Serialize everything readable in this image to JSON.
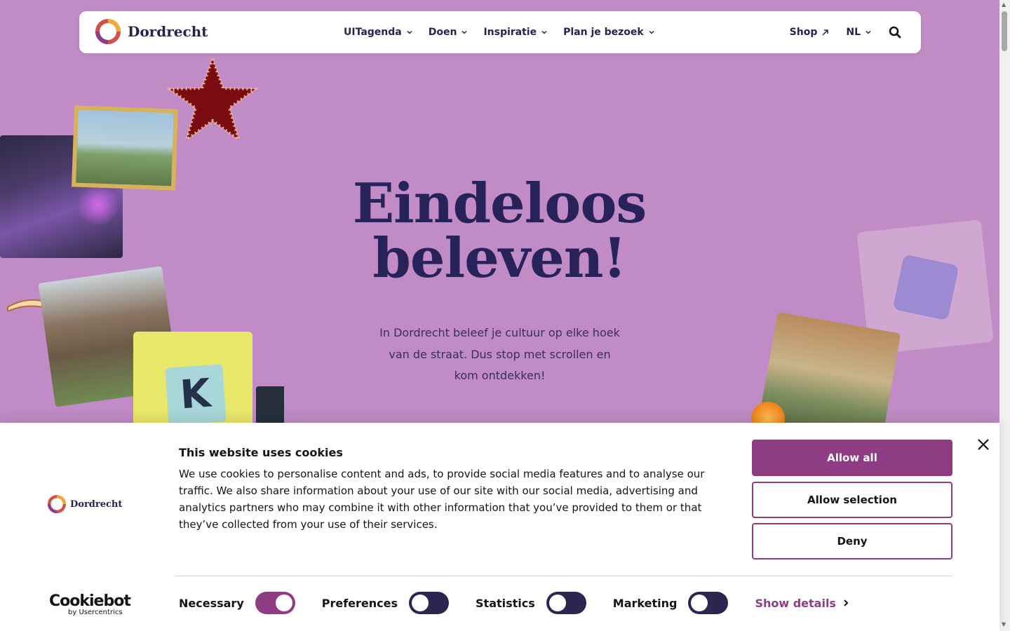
{
  "header": {
    "brand": "Dordrecht",
    "nav": [
      {
        "label": "UITagenda"
      },
      {
        "label": "Doen"
      },
      {
        "label": "Inspiratie"
      },
      {
        "label": "Plan je bezoek"
      }
    ],
    "shop_label": "Shop",
    "lang_label": "NL"
  },
  "hero": {
    "title_line1": "Eindeloos",
    "title_line2": "beleven!",
    "subtitle": "In Dordrecht beleef je cultuur op elke hoek van de straat. Dus stop met scrollen en kom ontdekken!",
    "k_letter": "K"
  },
  "cookie": {
    "brand": "Dordrecht",
    "title": "This website uses cookies",
    "text": "We use cookies to personalise content and ads, to provide social media features and to analyse our traffic. We also share information about your use of our site with our social media, advertising and analytics partners who may combine it with other information that you’ve provided to them or that they’ve collected from your use of their services.",
    "allow_all": "Allow all",
    "allow_selection": "Allow selection",
    "deny": "Deny",
    "provider": "Cookiebot",
    "provider_by": "by Usercentrics",
    "toggles": [
      {
        "label": "Necessary",
        "state": "on"
      },
      {
        "label": "Preferences",
        "state": "off"
      },
      {
        "label": "Statistics",
        "state": "off"
      },
      {
        "label": "Marketing",
        "state": "off"
      }
    ],
    "show_details": "Show details"
  },
  "colors": {
    "hero_bg": "#c18bc6",
    "accent": "#8e3c84",
    "navy": "#26234f"
  }
}
